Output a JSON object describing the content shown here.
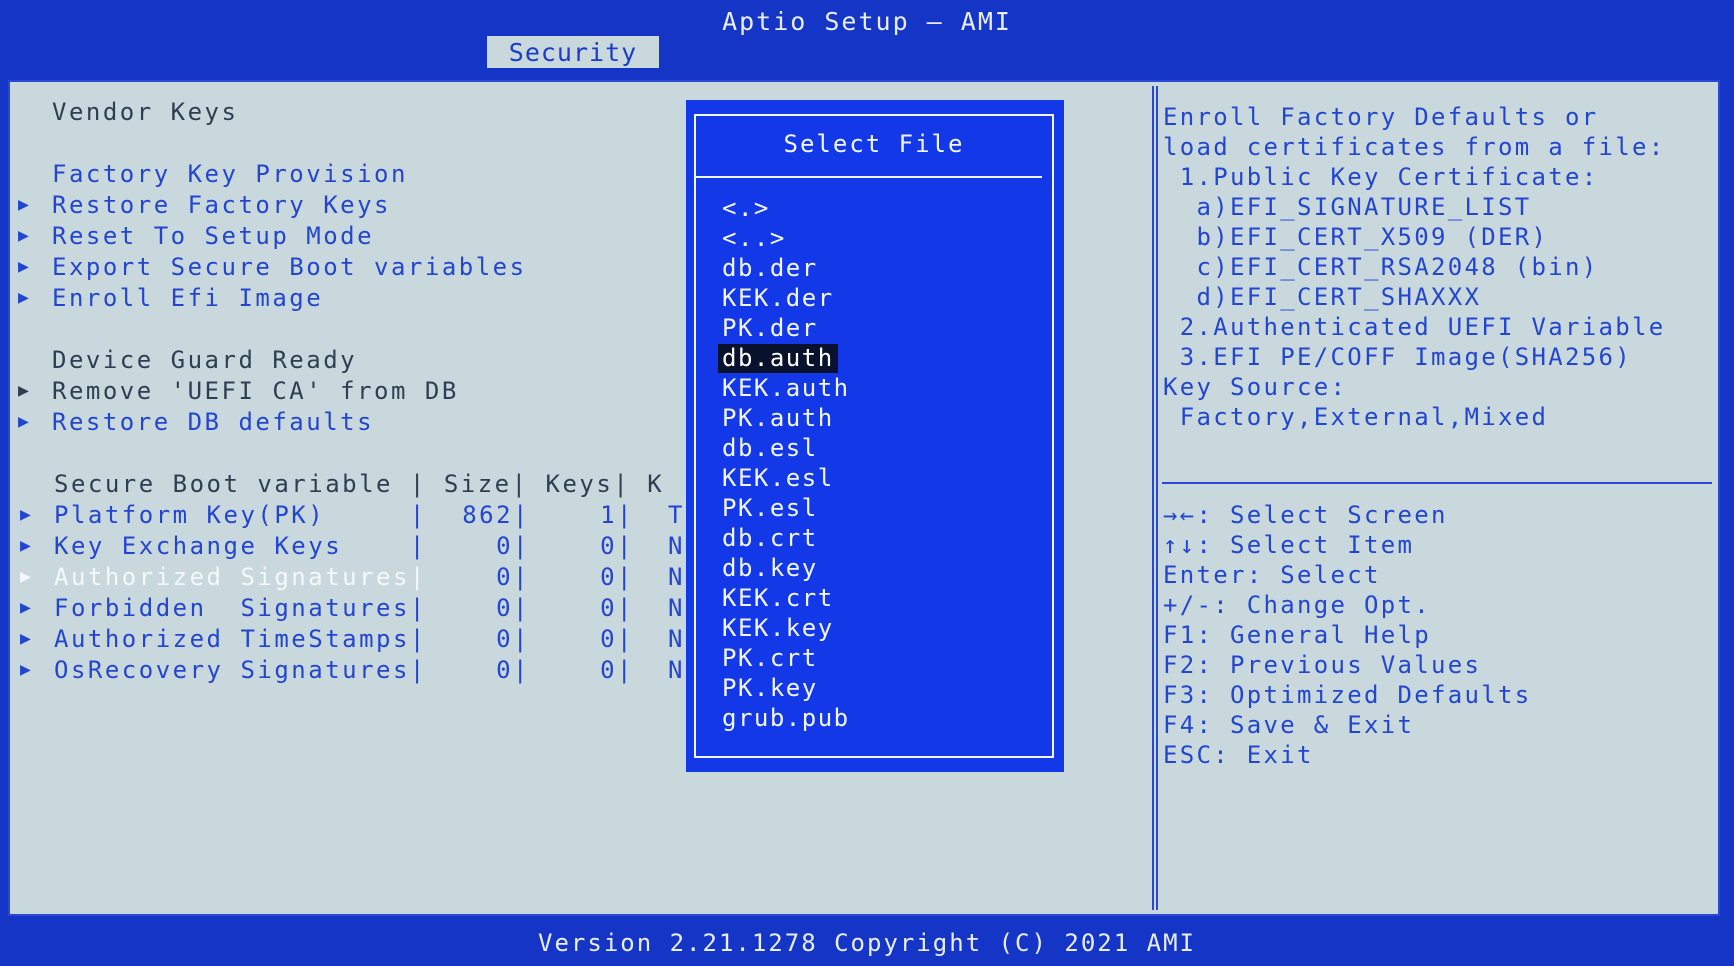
{
  "app": {
    "title": "Aptio Setup – AMI",
    "tab": "Security",
    "footer": "Version 2.21.1278 Copyright (C) 2021 AMI"
  },
  "left": {
    "vendor_keys": "Vendor Keys",
    "factory_key_provision": "Factory Key Provision",
    "restore_factory_keys": "Restore Factory Keys",
    "reset_to_setup_mode": "Reset To Setup Mode",
    "export_secure_boot": "Export Secure Boot variables",
    "enroll_efi_image": "Enroll Efi Image",
    "device_guard_ready": "Device Guard Ready",
    "remove_uefi_ca": "Remove 'UEFI CA' from DB",
    "restore_db_defaults": "Restore DB defaults",
    "table_header": "Secure Boot variable | Size| Keys| K",
    "rows": [
      {
        "name": "Platform Key(PK)     |",
        "size": "862|",
        "keys": "1|",
        "k": "T"
      },
      {
        "name": "Key Exchange Keys    |",
        "size": "0|",
        "keys": "0|",
        "k": "N"
      },
      {
        "name": "Authorized Signatures|",
        "size": "0|",
        "keys": "0|",
        "k": "N"
      },
      {
        "name": "Forbidden  Signatures|",
        "size": "0|",
        "keys": "0|",
        "k": "N"
      },
      {
        "name": "Authorized TimeStamps|",
        "size": "0|",
        "keys": "0|",
        "k": "N"
      },
      {
        "name": "OsRecovery Signatures|",
        "size": "0|",
        "keys": "0|",
        "k": "N"
      }
    ]
  },
  "popup": {
    "title": "Select File",
    "files": [
      "<.>",
      "<..>",
      "db.der",
      "KEK.der",
      "PK.der",
      "db.auth",
      "KEK.auth",
      "PK.auth",
      "db.esl",
      "KEK.esl",
      "PK.esl",
      "db.crt",
      "db.key",
      "KEK.crt",
      "KEK.key",
      "PK.crt",
      "PK.key",
      "grub.pub"
    ],
    "selected_index": 5
  },
  "help": {
    "lines": [
      "Enroll Factory Defaults or",
      "load certificates from a file:",
      " 1.Public Key Certificate:",
      "  a)EFI_SIGNATURE_LIST",
      "  b)EFI_CERT_X509 (DER)",
      "  c)EFI_CERT_RSA2048 (bin)",
      "  d)EFI_CERT_SHAXXX",
      " 2.Authenticated UEFI Variable",
      " 3.EFI PE/COFF Image(SHA256)",
      "Key Source:",
      " Factory,External,Mixed"
    ],
    "keys": [
      "→←: Select Screen",
      "↑↓: Select Item",
      "Enter: Select",
      "+/-: Change Opt.",
      "F1: General Help",
      "F2: Previous Values",
      "F3: Optimized Defaults",
      "F4: Save & Exit",
      "ESC: Exit"
    ]
  },
  "colors": {
    "background": "#1535c6",
    "panel": "#c9d8dd",
    "link": "#2346cf",
    "popup": "#1238e8"
  }
}
